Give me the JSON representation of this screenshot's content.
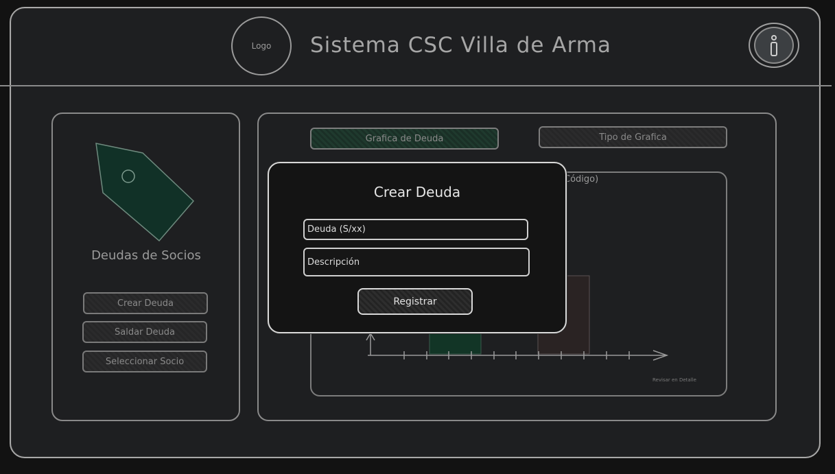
{
  "header": {
    "logo_text": "Logo",
    "title": "Sistema CSC Villa de Arma",
    "info_icon": "info-icon"
  },
  "sidebar": {
    "illustration_icon": "price-tag-icon",
    "section_title": "Deudas de Socios",
    "buttons": [
      {
        "label": "Crear Deuda"
      },
      {
        "label": "Saldar Deuda"
      },
      {
        "label": "Seleccionar Socio"
      }
    ]
  },
  "main": {
    "tabs": [
      {
        "label": "Grafica de Deuda",
        "active": true
      },
      {
        "label": "Tipo de Grafica",
        "active": false
      }
    ],
    "chart_title_visible": "Código)",
    "detail_link": "Revisar en Detalle"
  },
  "modal": {
    "title": "Crear Deuda",
    "amount_placeholder": "Deuda (S/xx)",
    "description_placeholder": "Descripción",
    "submit_label": "Registrar"
  },
  "colors": {
    "background": "#121212",
    "frame": "#1e1f21",
    "accent_green": "#113127",
    "modal_border": "#d9d9d9"
  }
}
